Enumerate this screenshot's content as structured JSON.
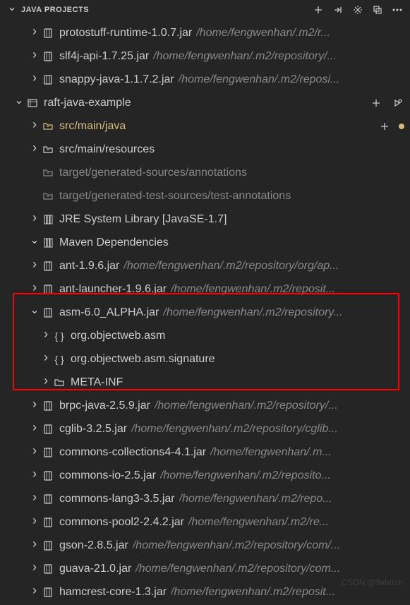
{
  "header": {
    "title": "JAVA PROJECTS"
  },
  "topJars": [
    {
      "name": "protostuff-runtime-1.0.7.jar",
      "path": "/home/fengwenhan/.m2/r..."
    },
    {
      "name": "slf4j-api-1.7.25.jar",
      "path": "/home/fengwenhan/.m2/repository/..."
    },
    {
      "name": "snappy-java-1.1.7.2.jar",
      "path": "/home/fengwenhan/.m2/reposi..."
    }
  ],
  "project": {
    "name": "raft-java-example"
  },
  "srcMain": "src/main/java",
  "srcResources": "src/main/resources",
  "genSources": "target/generated-sources/annotations",
  "genTestSources": "target/generated-test-sources/test-annotations",
  "jreLib": "JRE System Library [JavaSE-1.7]",
  "mavenDeps": "Maven Dependencies",
  "deps": [
    {
      "name": "ant-1.9.6.jar",
      "path": "/home/fengwenhan/.m2/repository/org/ap...",
      "expanded": false
    },
    {
      "name": "ant-launcher-1.9.6.jar",
      "path": "/home/fengwenhan/.m2/reposit...",
      "expanded": false
    },
    {
      "name": "asm-6.0_ALPHA.jar",
      "path": "/home/fengwenhan/.m2/repository...",
      "expanded": true,
      "children": [
        {
          "name": "org.objectweb.asm",
          "type": "package"
        },
        {
          "name": "org.objectweb.asm.signature",
          "type": "package"
        },
        {
          "name": "META-INF",
          "type": "folder"
        }
      ]
    },
    {
      "name": "brpc-java-2.5.9.jar",
      "path": "/home/fengwenhan/.m2/repository/...",
      "expanded": false
    },
    {
      "name": "cglib-3.2.5.jar",
      "path": "/home/fengwenhan/.m2/repository/cglib...",
      "expanded": false
    },
    {
      "name": "commons-collections4-4.1.jar",
      "path": "/home/fengwenhan/.m...",
      "expanded": false
    },
    {
      "name": "commons-io-2.5.jar",
      "path": "/home/fengwenhan/.m2/reposito...",
      "expanded": false
    },
    {
      "name": "commons-lang3-3.5.jar",
      "path": "/home/fengwenhan/.m2/repo...",
      "expanded": false
    },
    {
      "name": "commons-pool2-2.4.2.jar",
      "path": "/home/fengwenhan/.m2/re...",
      "expanded": false
    },
    {
      "name": "gson-2.8.5.jar",
      "path": "/home/fengwenhan/.m2/repository/com/...",
      "expanded": false
    },
    {
      "name": "guava-21.0.jar",
      "path": "/home/fengwenhan/.m2/repository/com...",
      "expanded": false
    },
    {
      "name": "hamcrest-core-1.3.jar",
      "path": "/home/fengwenhan/.m2/reposit...",
      "expanded": false
    }
  ],
  "watermark": "CSDN @fwhdzh"
}
